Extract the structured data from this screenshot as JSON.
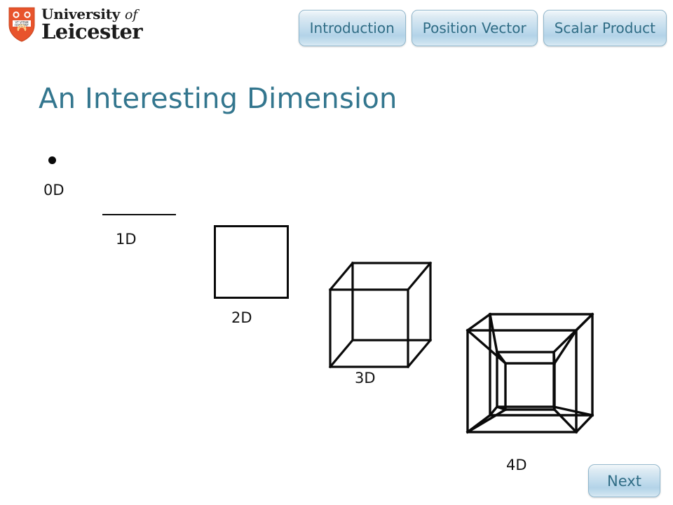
{
  "header": {
    "logo": {
      "shield_icon": "university-crest-shield-icon",
      "shield_color": "#e8542c",
      "line1_plain": "University",
      "line1_italic": "of",
      "line2": "Leicester",
      "motto": "VT VITAM HABEANT"
    },
    "nav_buttons": [
      {
        "label": "Introduction"
      },
      {
        "label": "Position Vector"
      },
      {
        "label": "Scalar Product"
      }
    ]
  },
  "title": "An Interesting Dimension",
  "diagram": {
    "accent_title_color": "#33768e",
    "stroke_color": "#0a0a0a",
    "items": [
      {
        "label": "0D",
        "shape": "point"
      },
      {
        "label": "1D",
        "shape": "line-segment"
      },
      {
        "label": "2D",
        "shape": "square"
      },
      {
        "label": "3D",
        "shape": "cube-wireframe"
      },
      {
        "label": "4D",
        "shape": "tesseract-wireframe"
      }
    ]
  },
  "footer": {
    "next_label": "Next"
  }
}
